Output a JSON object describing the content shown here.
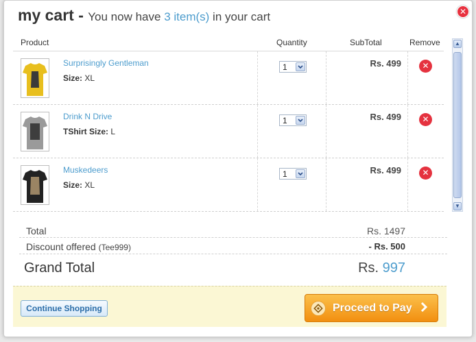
{
  "header": {
    "title": "my cart -",
    "subtitle_pre": "You now have",
    "item_count": "3 item(s)",
    "subtitle_post": "in your cart"
  },
  "table": {
    "headers": {
      "product": "Product",
      "quantity": "Quantity",
      "subtotal": "SubTotal",
      "remove": "Remove"
    },
    "items": [
      {
        "name": "Surprisingly Gentleman",
        "size_label": "Size:",
        "size": "XL",
        "qty": "1",
        "price": "Rs. 499",
        "shirt_color": "#e8bf1e",
        "print_color": "#3a3a3a"
      },
      {
        "name": "Drink N Drive",
        "size_label": "TShirt Size:",
        "size": "L",
        "qty": "1",
        "price": "Rs. 499",
        "shirt_color": "#9a9a9a",
        "print_color": "#3e3e3e"
      },
      {
        "name": "Muskedeers",
        "size_label": "Size:",
        "size": "XL",
        "qty": "1",
        "price": "Rs. 499",
        "shirt_color": "#222222",
        "print_color": "#9a8463"
      }
    ]
  },
  "totals": {
    "total_label": "Total",
    "total_value": "Rs. 1497",
    "discount_label": "Discount offered",
    "discount_code": "(Tee999)",
    "discount_value": "- Rs. 500",
    "grand_label": "Grand Total",
    "grand_currency": "Rs.",
    "grand_amount": "997"
  },
  "footer": {
    "continue_label": "Continue Shopping",
    "proceed_label": "Proceed to Pay"
  },
  "icons": {
    "close": "close-icon",
    "remove": "remove-icon",
    "select_arrow": "chevron-down-icon",
    "proceed_badge": "payment-icon",
    "proceed_arrow": "chevron-right-icon"
  },
  "colors": {
    "accent": "#4c9ccd",
    "danger": "#e5323f",
    "proceed": "#f28f10",
    "footer_bg": "#fbf7d4"
  }
}
